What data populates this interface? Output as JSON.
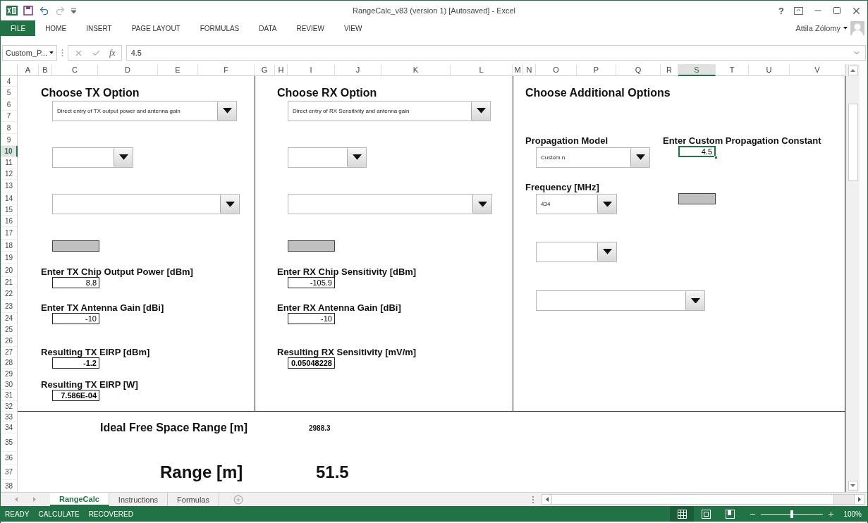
{
  "title_bar": {
    "title": "RangeCalc_v83 (version 1) [Autosaved] - Excel",
    "help": "?"
  },
  "ribbon_tabs": [
    {
      "label": "FILE",
      "kind": "file"
    },
    {
      "label": "HOME",
      "kind": "tab"
    },
    {
      "label": "INSERT",
      "kind": "tab"
    },
    {
      "label": "PAGE LAYOUT",
      "kind": "tab"
    },
    {
      "label": "FORMULAS",
      "kind": "tab"
    },
    {
      "label": "DATA",
      "kind": "tab"
    },
    {
      "label": "REVIEW",
      "kind": "tab"
    },
    {
      "label": "VIEW",
      "kind": "tab"
    }
  ],
  "user": {
    "name": "Attila Zólomy"
  },
  "formula_bar": {
    "name_box": "Custom_P...",
    "function_label": "fx",
    "formula": "4.5"
  },
  "column_headers": [
    {
      "label": "A",
      "selected": false
    },
    {
      "label": "B",
      "selected": false
    },
    {
      "label": "C",
      "selected": false
    },
    {
      "label": "D",
      "selected": false
    },
    {
      "label": "E",
      "selected": false
    },
    {
      "label": "F",
      "selected": false
    },
    {
      "label": "G",
      "selected": false
    },
    {
      "label": "H",
      "selected": false
    },
    {
      "label": "I",
      "selected": false
    },
    {
      "label": "J",
      "selected": false
    },
    {
      "label": "K",
      "selected": false
    },
    {
      "label": "L",
      "selected": false
    },
    {
      "label": "M",
      "selected": false
    },
    {
      "label": "N",
      "selected": false
    },
    {
      "label": "O",
      "selected": false
    },
    {
      "label": "P",
      "selected": false
    },
    {
      "label": "Q",
      "selected": false
    },
    {
      "label": "R",
      "selected": false
    },
    {
      "label": "S",
      "selected": true
    },
    {
      "label": "T",
      "selected": false
    },
    {
      "label": "U",
      "selected": false
    },
    {
      "label": "V",
      "selected": false
    }
  ],
  "row_headers": [
    {
      "label": "4",
      "selected": false
    },
    {
      "label": "5",
      "selected": false
    },
    {
      "label": "6",
      "selected": false
    },
    {
      "label": "7",
      "selected": false
    },
    {
      "label": "8",
      "selected": false
    },
    {
      "label": "9",
      "selected": false
    },
    {
      "label": "10",
      "selected": true
    },
    {
      "label": "11",
      "selected": false
    },
    {
      "label": "12",
      "selected": false
    },
    {
      "label": "13",
      "selected": false
    },
    {
      "label": "14",
      "selected": false
    },
    {
      "label": "15",
      "selected": false
    },
    {
      "label": "16",
      "selected": false
    },
    {
      "label": "17",
      "selected": false
    },
    {
      "label": "18",
      "selected": false
    },
    {
      "label": "19",
      "selected": false
    },
    {
      "label": "20",
      "selected": false
    },
    {
      "label": "21",
      "selected": false
    },
    {
      "label": "22",
      "selected": false
    },
    {
      "label": "23",
      "selected": false
    },
    {
      "label": "24",
      "selected": false
    },
    {
      "label": "25",
      "selected": false
    },
    {
      "label": "26",
      "selected": false
    },
    {
      "label": "27",
      "selected": false
    },
    {
      "label": "28",
      "selected": false
    },
    {
      "label": "29",
      "selected": false
    },
    {
      "label": "30",
      "selected": false
    },
    {
      "label": "31",
      "selected": false
    },
    {
      "label": "32",
      "selected": false
    },
    {
      "label": "33",
      "selected": false
    },
    {
      "label": "34",
      "selected": false
    },
    {
      "label": "35",
      "selected": false
    },
    {
      "label": "36",
      "selected": false
    },
    {
      "label": "37",
      "selected": false
    },
    {
      "label": "38",
      "selected": false
    }
  ],
  "tx": {
    "heading": "Choose TX Option",
    "option": "Direct entry of TX output power and antenna gain",
    "fields": [
      {
        "label": "Enter TX Chip Output Power [dBm]",
        "value": "8.8",
        "kind": "input"
      },
      {
        "label": "Enter TX Antenna Gain [dBi]",
        "value": "-10",
        "kind": "input"
      },
      {
        "label": "Resulting TX EIRP [dBm]",
        "value": "-1.2",
        "kind": "result"
      },
      {
        "label": "Resulting TX EIRP [W]",
        "value": "7.586E-04",
        "kind": "result"
      }
    ]
  },
  "rx": {
    "heading": "Choose RX Option",
    "option": "Direct entry of RX Sensitivity and antenna gain",
    "fields": [
      {
        "label": "Enter RX Chip Sensitivity [dBm]",
        "value": "-105.9",
        "kind": "input"
      },
      {
        "label": "Enter RX Antenna Gain [dBi]",
        "value": "-10",
        "kind": "input"
      },
      {
        "label": "Resulting RX Sensitivity [mV/m]",
        "value": "0.05048228",
        "kind": "result"
      }
    ]
  },
  "additional": {
    "heading": "Choose Additional Options",
    "propagation_label": "Propagation Model",
    "propagation_value": "Custom n",
    "constant_label": "Enter Custom Propagation Constant",
    "constant_value": "4.5",
    "constant_selected": true,
    "frequency_label": "Frequency [MHz]",
    "frequency_value": "434"
  },
  "results": [
    {
      "label": "Ideal Free Space Range [m]",
      "value": "2988.3",
      "kind": "small"
    },
    {
      "label": "Range [m]",
      "value": "51.5",
      "kind": "large"
    }
  ],
  "sheet_tabs": [
    {
      "label": "RangeCalc",
      "selected": true
    },
    {
      "label": "Instructions",
      "selected": false
    },
    {
      "label": "Formulas",
      "selected": false
    }
  ],
  "status_bar": {
    "items": [
      "READY",
      "CALCULATE",
      "RECOVERED"
    ],
    "view_buttons": [
      {
        "selected": true
      },
      {
        "selected": false
      },
      {
        "selected": false
      }
    ],
    "zoom": {
      "level": 0.5,
      "label": "100%"
    }
  }
}
